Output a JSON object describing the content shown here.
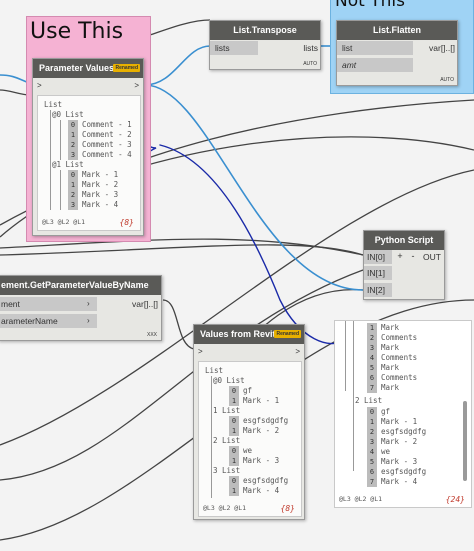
{
  "groups": {
    "use_this": "Use This",
    "not_this": "Not This"
  },
  "transpose": {
    "title": "List.Transpose",
    "in": "lists",
    "out": "lists",
    "lacing": "AUTO"
  },
  "flatten": {
    "title": "List.Flatten",
    "in1": "list",
    "in2": "amt",
    "out": "var[]..[]",
    "lacing": "AUTO"
  },
  "param_values": {
    "title": "Parameter Values",
    "badge": "Renamed",
    "in_arrow": ">",
    "out_arrow": ">",
    "tree": {
      "root": "List",
      "l0": "@0 List",
      "l0_items": [
        [
          "0",
          "Comment - 1"
        ],
        [
          "1",
          "Comment - 2"
        ],
        [
          "2",
          "Comment - 3"
        ],
        [
          "3",
          "Comment - 4"
        ]
      ],
      "l1": "@1 List",
      "l1_items": [
        [
          "0",
          "Mark - 1"
        ],
        [
          "1",
          "Mark - 2"
        ],
        [
          "2",
          "Mark - 3"
        ],
        [
          "3",
          "Mark - 4"
        ]
      ]
    },
    "levels": "@L3 @L2 @L1",
    "count": "{8}"
  },
  "python": {
    "title": "Python Script",
    "plus": "+",
    "minus": "-",
    "out": "OUT",
    "inputs": [
      "IN[0]",
      "IN[1]",
      "IN[2]"
    ]
  },
  "getparam": {
    "title": "ement.GetParameterValueByName",
    "in1": "ment",
    "in2": "arameterName",
    "out": "var[]..[]",
    "lacing": "XXX"
  },
  "from_revit": {
    "title": "Values from Revit",
    "badge": "Renamed",
    "tree": {
      "root": "List",
      "g0": "@0 List",
      "g0_items": [
        [
          "0",
          "gf"
        ],
        [
          "1",
          "Mark - 1"
        ]
      ],
      "g1": "1 List",
      "g1_items": [
        [
          "0",
          "esgfsdgdfg"
        ],
        [
          "1",
          "Mark - 2"
        ]
      ],
      "g2": "2 List",
      "g2_items": [
        [
          "0",
          "we"
        ],
        [
          "1",
          "Mark - 3"
        ]
      ],
      "g3": "3 List",
      "g3_items": [
        [
          "0",
          "esgfsdgdfg"
        ],
        [
          "1",
          "Mark - 4"
        ]
      ]
    },
    "levels": "@L3 @L2 @L1",
    "count": "{8}"
  },
  "preview24": {
    "items_top": [
      [
        "1",
        "Mark"
      ],
      [
        "2",
        "Comments"
      ],
      [
        "3",
        "Mark"
      ],
      [
        "4",
        "Comments"
      ],
      [
        "5",
        "Mark"
      ],
      [
        "6",
        "Comments"
      ],
      [
        "7",
        "Mark"
      ]
    ],
    "sub": "2 List",
    "items_bottom": [
      [
        "0",
        "gf"
      ],
      [
        "1",
        "Mark - 1"
      ],
      [
        "2",
        "esgfsdgdfg"
      ],
      [
        "3",
        "Mark - 2"
      ],
      [
        "4",
        "we"
      ],
      [
        "5",
        "Mark - 3"
      ],
      [
        "6",
        "esgfsdgdfg"
      ],
      [
        "7",
        "Mark - 4"
      ]
    ],
    "levels": "@L3 @L2 @L1",
    "count": "{24}"
  },
  "colors": {
    "use_this_group": "#f5b2d3",
    "not_this_group": "#9fd3f5",
    "annotation": "#1a2aa8",
    "wire_selected": "#3a8fd0"
  }
}
